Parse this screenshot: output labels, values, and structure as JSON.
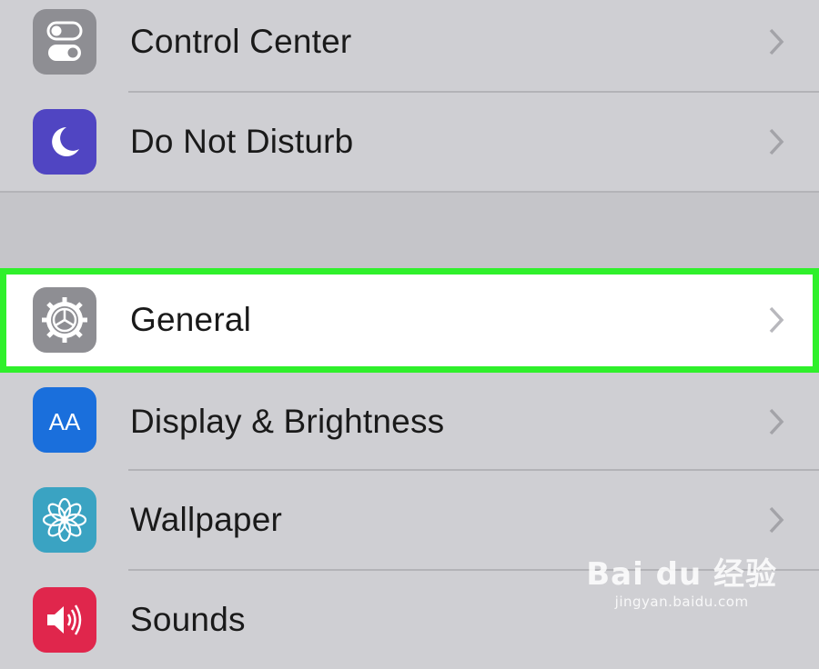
{
  "settings": {
    "items": [
      {
        "label": "Control Center",
        "icon": "toggle-switch-icon",
        "icon_color": "#8e8e93"
      },
      {
        "label": "Do Not Disturb",
        "icon": "moon-icon",
        "icon_color": "#5045c2"
      },
      {
        "label": "General",
        "icon": "gear-icon",
        "icon_color": "#8e8e93",
        "highlighted": true
      },
      {
        "label": "Display & Brightness",
        "icon": "text-size-icon",
        "icon_color": "#1a6fdc",
        "icon_text": "AA"
      },
      {
        "label": "Wallpaper",
        "icon": "flower-icon",
        "icon_color": "#3aa3c2"
      },
      {
        "label": "Sounds",
        "icon": "speaker-icon",
        "icon_color": "#e0264c"
      }
    ]
  },
  "highlight_color": "#2ff02b",
  "watermark": {
    "main": "Bai du 经验",
    "sub": "jingyan.baidu.com"
  }
}
